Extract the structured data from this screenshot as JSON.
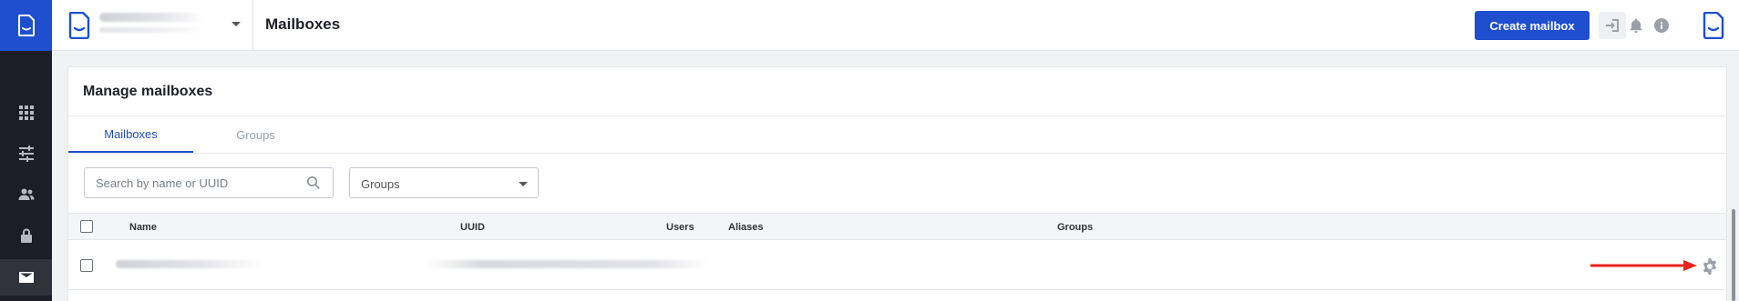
{
  "header": {
    "title": "Mailboxes",
    "create_button_label": "Create mailbox"
  },
  "sidebar": {
    "items": [
      {
        "icon": "apps-grid-icon"
      },
      {
        "icon": "sliders-icon"
      },
      {
        "icon": "users-icon"
      },
      {
        "icon": "lock-icon"
      },
      {
        "icon": "mail-icon",
        "active": true
      }
    ]
  },
  "card": {
    "title": "Manage mailboxes",
    "tabs": [
      {
        "label": "Mailboxes",
        "active": true
      },
      {
        "label": "Groups",
        "active": false
      }
    ],
    "search": {
      "placeholder": "Search by name or UUID",
      "value": ""
    },
    "groups_filter": {
      "selected": "Groups"
    },
    "table": {
      "columns": [
        "Name",
        "UUID",
        "Users",
        "Aliases",
        "Groups"
      ]
    }
  },
  "colors": {
    "accent": "#1f4fcf",
    "rail": "#1b1e27",
    "annotation_arrow": "#e8251d"
  }
}
